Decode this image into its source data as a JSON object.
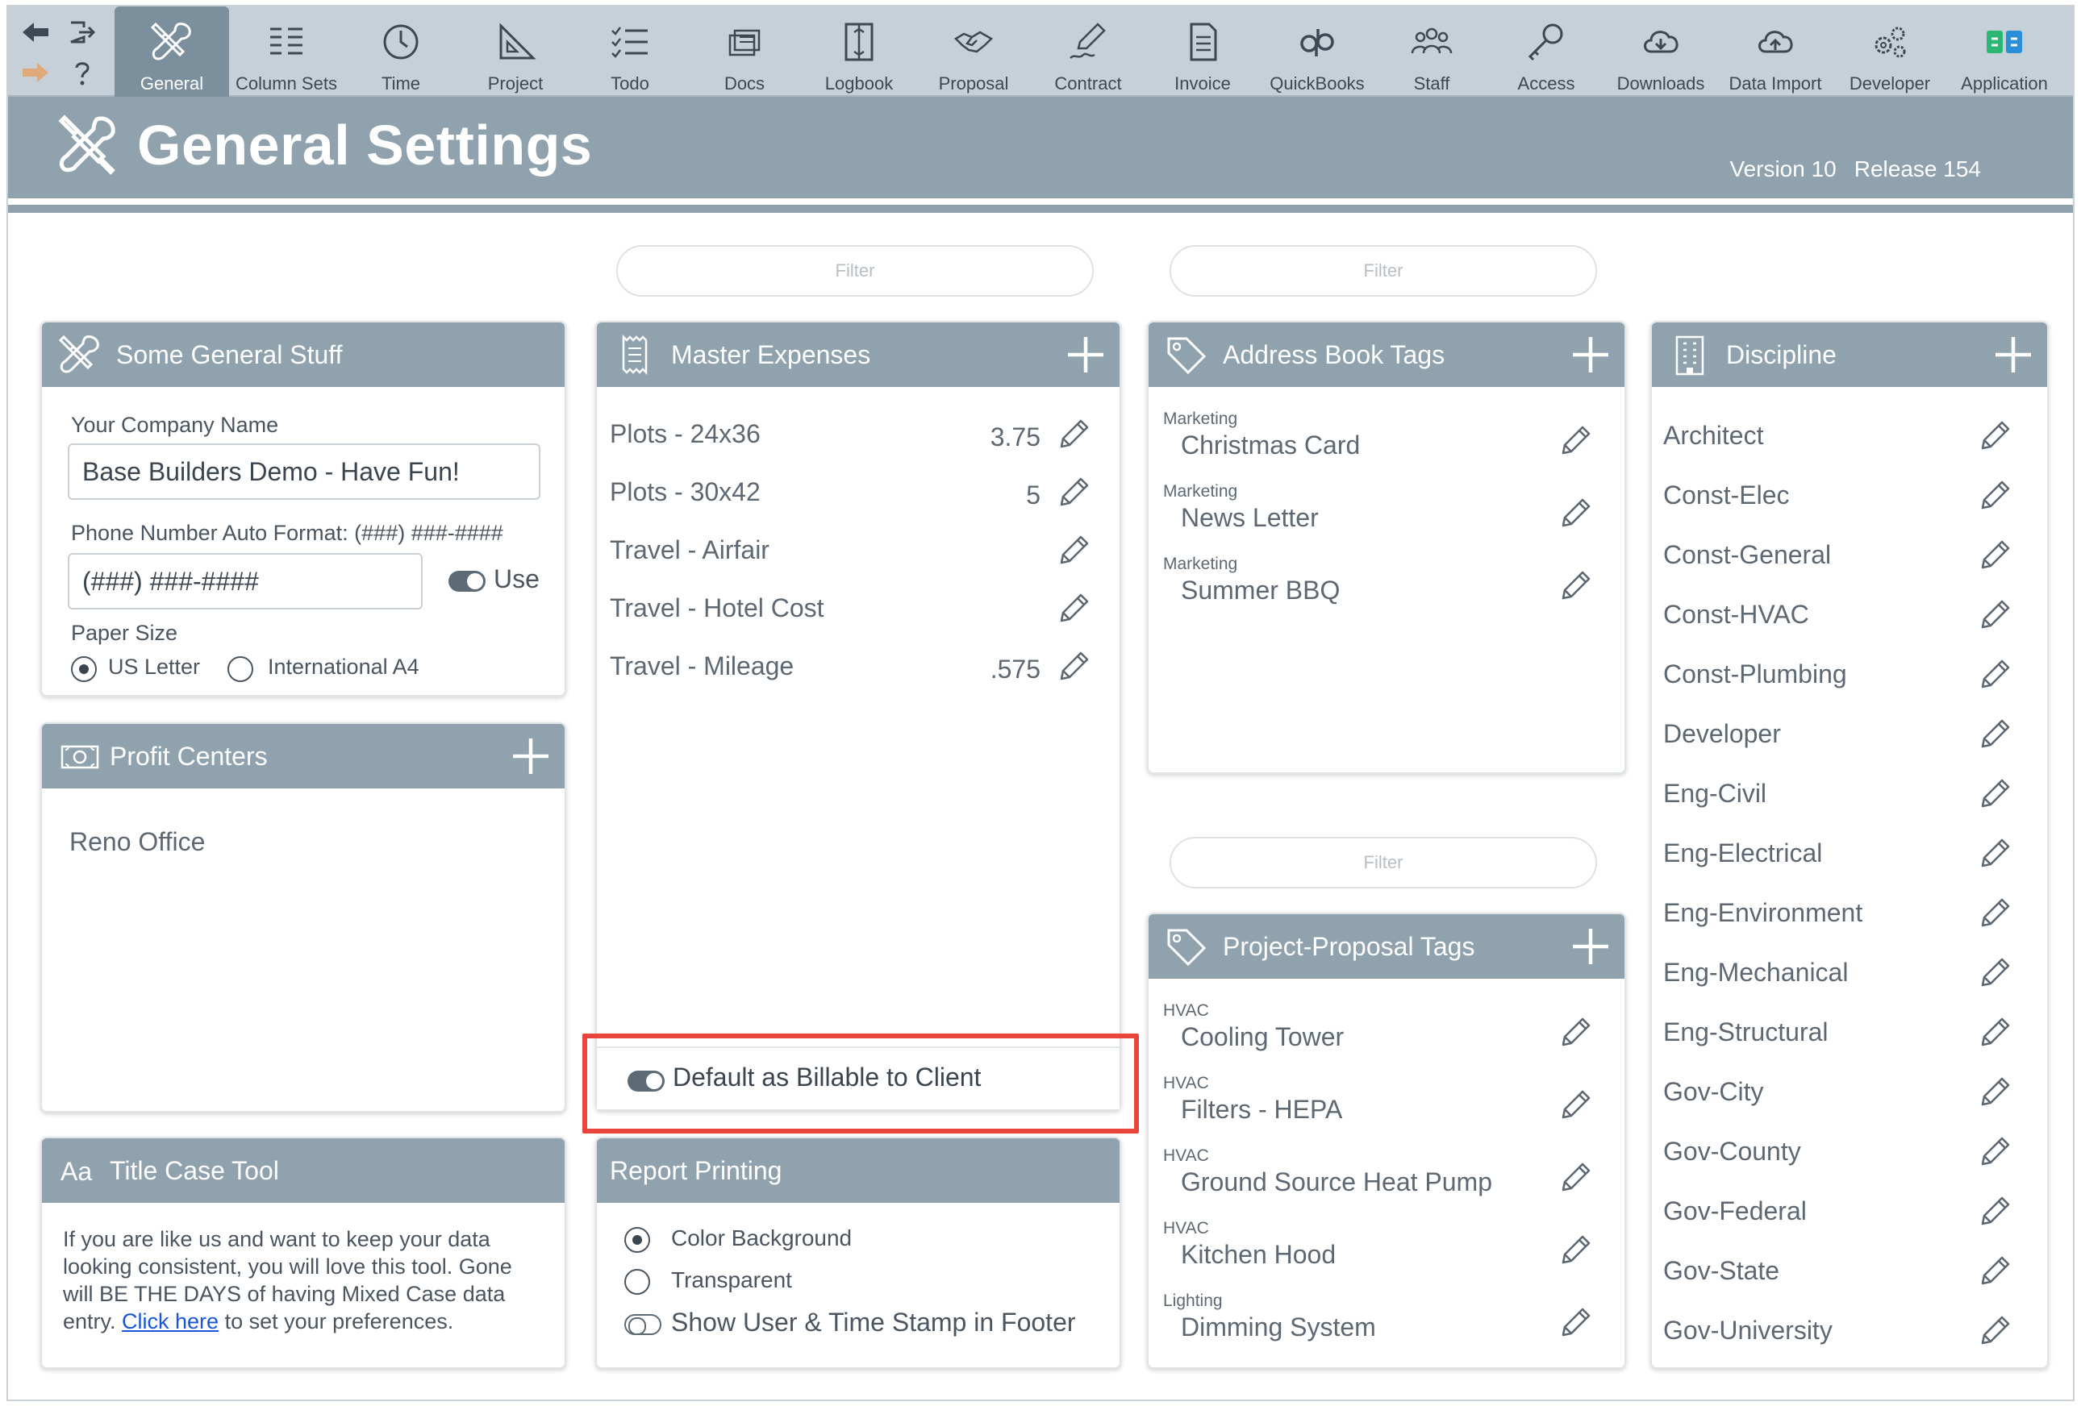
{
  "toolbar": {
    "items": [
      {
        "label": "General",
        "icon": "tools-icon",
        "active": true
      },
      {
        "label": "Column Sets",
        "icon": "columns-icon"
      },
      {
        "label": "Time",
        "icon": "clock-icon"
      },
      {
        "label": "Project",
        "icon": "triangle-ruler-icon"
      },
      {
        "label": "Todo",
        "icon": "checklist-icon"
      },
      {
        "label": "Docs",
        "icon": "docs-icon"
      },
      {
        "label": "Logbook",
        "icon": "logbook-icon"
      },
      {
        "label": "Proposal",
        "icon": "handshake-icon"
      },
      {
        "label": "Contract",
        "icon": "pen-sign-icon"
      },
      {
        "label": "Invoice",
        "icon": "invoice-icon"
      },
      {
        "label": "QuickBooks",
        "icon": "quickbooks-icon"
      },
      {
        "label": "Staff",
        "icon": "people-icon"
      },
      {
        "label": "Access",
        "icon": "key-icon"
      },
      {
        "label": "Downloads",
        "icon": "cloud-download-icon"
      },
      {
        "label": "Data Import",
        "icon": "cloud-upload-icon"
      },
      {
        "label": "Developer",
        "icon": "gears-icon"
      },
      {
        "label": "Application",
        "icon": "application-icon"
      }
    ]
  },
  "header": {
    "title": "General Settings",
    "version": "Version 10",
    "release": "Release 154"
  },
  "filters": {
    "expenses": "Filter",
    "address_tags": "Filter",
    "proposal_tags": "Filter"
  },
  "general": {
    "title": "Some General Stuff",
    "company_label": "Your Company Name",
    "company_value": "Base Builders Demo - Have Fun!",
    "phone_label": "Phone Number Auto Format:  (###) ###-####",
    "phone_value": "(###) ###-####",
    "use_label": "Use",
    "paper_label": "Paper Size",
    "paper_us": "US Letter",
    "paper_a4": "International A4"
  },
  "profit_centers": {
    "title": "Profit Centers",
    "items": [
      "Reno Office"
    ]
  },
  "title_case": {
    "title": "Title Case Tool",
    "text_1": "If you are like us and want to keep your data",
    "text_2": "looking consistent, you will love this tool. Gone",
    "text_3": "will BE THE DAYS of having Mixed Case data",
    "text_4a": "entry. ",
    "link": "Click here",
    "text_4b": " to set your preferences."
  },
  "expenses": {
    "title": "Master Expenses",
    "items": [
      {
        "name": "Plots - 24x36",
        "value": "3.75"
      },
      {
        "name": "Plots - 30x42",
        "value": "5"
      },
      {
        "name": "Travel - Airfair",
        "value": ""
      },
      {
        "name": "Travel - Hotel Cost",
        "value": ""
      },
      {
        "name": "Travel - Mileage",
        "value": ".575"
      }
    ],
    "billable_label": "Default as Billable to Client"
  },
  "report": {
    "title": "Report Printing",
    "color_bg": "Color Background",
    "transparent": "Transparent",
    "stamp": "Show User & Time Stamp in Footer"
  },
  "address_tags": {
    "title": "Address Book Tags",
    "items": [
      {
        "category": "Marketing",
        "name": "Christmas Card"
      },
      {
        "category": "Marketing",
        "name": "News Letter"
      },
      {
        "category": "Marketing",
        "name": "Summer BBQ"
      }
    ]
  },
  "proposal_tags": {
    "title": "Project-Proposal Tags",
    "items": [
      {
        "category": "HVAC",
        "name": "Cooling Tower"
      },
      {
        "category": "HVAC",
        "name": "Filters - HEPA"
      },
      {
        "category": "HVAC",
        "name": "Ground Source Heat Pump"
      },
      {
        "category": "HVAC",
        "name": "Kitchen Hood"
      },
      {
        "category": "Lighting",
        "name": "Dimming System"
      }
    ]
  },
  "discipline": {
    "title": "Discipline",
    "items": [
      "Architect",
      "Const-Elec",
      "Const-General",
      "Const-HVAC",
      "Const-Plumbing",
      "Developer",
      "Eng-Civil",
      "Eng-Electrical",
      "Eng-Environment",
      "Eng-Mechanical",
      "Eng-Structural",
      "Gov-City",
      "Gov-County",
      "Gov-Federal",
      "Gov-State",
      "Gov-University"
    ]
  },
  "colors": {
    "header_bg": "#8fa2ae",
    "toolbar_bg": "#c6d0d8",
    "active_tab": "#7b8f9d",
    "highlight": "#e8453c",
    "link": "#1a55d6"
  }
}
